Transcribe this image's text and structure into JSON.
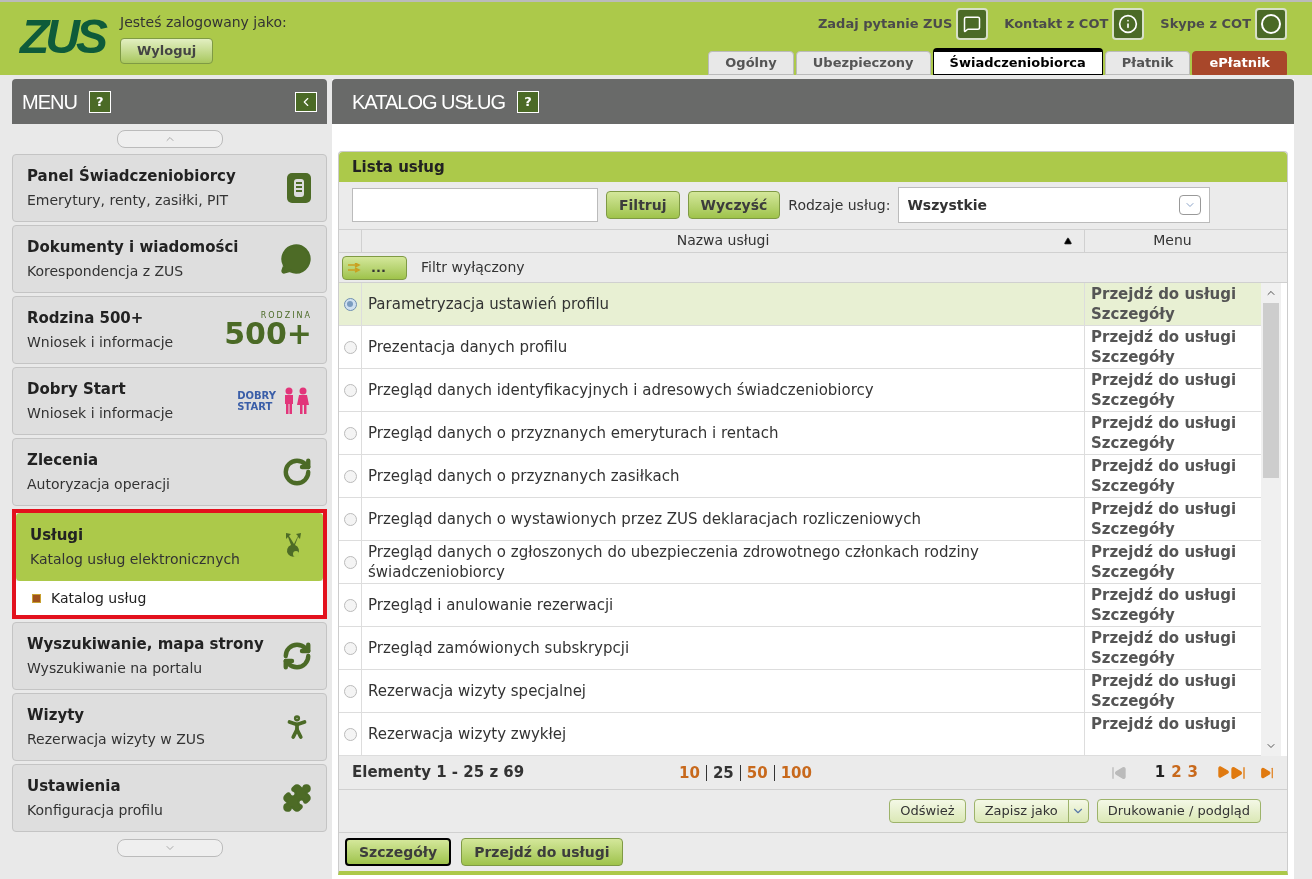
{
  "header": {
    "logo": "ZUS",
    "logged_in_label": "Jesteś zalogowany jako:",
    "logout_button": "Wyloguj",
    "links": [
      {
        "label": "Zadaj pytanie ZUS"
      },
      {
        "label": "Kontakt z COT"
      },
      {
        "label": "Skype z COT"
      }
    ],
    "tabs": [
      {
        "label": "Ogólny",
        "selected": false,
        "kind": "normal"
      },
      {
        "label": "Ubezpieczony",
        "selected": false,
        "kind": "normal"
      },
      {
        "label": "Świadczeniobiorca",
        "selected": true,
        "kind": "normal"
      },
      {
        "label": "Płatnik",
        "selected": false,
        "kind": "normal"
      },
      {
        "label": "ePłatnik",
        "selected": false,
        "kind": "accent"
      }
    ]
  },
  "sidebar": {
    "title": "MENU",
    "help": "?",
    "items": [
      {
        "title": "Panel Świadczeniobiorcy",
        "subtitle": "Emerytury, renty, zasiłki, PIT",
        "selected": false
      },
      {
        "title": "Dokumenty i wiadomości",
        "subtitle": "Korespondencja z ZUS",
        "selected": false
      },
      {
        "title": "Rodzina 500+",
        "subtitle": "Wniosek i informacje",
        "logo": [
          "RODZINA",
          "500+"
        ],
        "selected": false
      },
      {
        "title": "Dobry Start",
        "subtitle": "Wniosek i informacje",
        "logo": [
          "DOBRY",
          "START"
        ],
        "selected": false
      },
      {
        "title": "Zlecenia",
        "subtitle": "Autoryzacja operacji",
        "selected": false
      },
      {
        "title": "Usługi",
        "subtitle": "Katalog usług elektronicznych",
        "selected": true,
        "children": [
          {
            "label": "Katalog usług"
          }
        ]
      },
      {
        "title": "Wyszukiwanie, mapa strony",
        "subtitle": "Wyszukiwanie na portalu",
        "selected": false
      },
      {
        "title": "Wizyty",
        "subtitle": "Rezerwacja wizyty w ZUS",
        "selected": false
      },
      {
        "title": "Ustawienia",
        "subtitle": "Konfiguracja profilu",
        "selected": false
      }
    ]
  },
  "main": {
    "title": "KATALOG USŁUG",
    "help": "?",
    "panel_title": "Lista usług",
    "filter_button": "Filtruj",
    "clear_button": "Wyczyść",
    "type_label": "Rodzaje usług:",
    "type_value": "Wszystkie",
    "columns": [
      "Nazwa usługi",
      "Menu"
    ],
    "filter_toggle": "...",
    "filter_status": "Filtr wyłączony",
    "rows": [
      {
        "name": "Parametryzacja ustawień profilu",
        "selected": true,
        "actions": [
          "Przejdź do usługi",
          "Szczegóły"
        ]
      },
      {
        "name": "Prezentacja danych profilu",
        "selected": false,
        "actions": [
          "Przejdź do usługi",
          "Szczegóły"
        ]
      },
      {
        "name": "Przegląd danych identyfikacyjnych i adresowych świadczeniobiorcy",
        "selected": false,
        "actions": [
          "Przejdź do usługi",
          "Szczegóły"
        ]
      },
      {
        "name": "Przegląd danych o przyznanych emeryturach i rentach",
        "selected": false,
        "actions": [
          "Przejdź do usługi",
          "Szczegóły"
        ]
      },
      {
        "name": "Przegląd danych o przyznanych zasiłkach",
        "selected": false,
        "actions": [
          "Przejdź do usługi",
          "Szczegóły"
        ]
      },
      {
        "name": "Przegląd danych o wystawionych przez ZUS deklaracjach rozliczeniowych",
        "selected": false,
        "actions": [
          "Przejdź do usługi",
          "Szczegóły"
        ]
      },
      {
        "name": "Przegląd danych o zgłoszonych do ubezpieczenia zdrowotnego członkach rodziny świadczeniobiorcy",
        "selected": false,
        "actions": [
          "Przejdź do usługi",
          "Szczegóły"
        ]
      },
      {
        "name": "Przegląd i anulowanie rezerwacji",
        "selected": false,
        "actions": [
          "Przejdź do usługi",
          "Szczegóły"
        ]
      },
      {
        "name": "Przegląd zamówionych subskrypcji",
        "selected": false,
        "actions": [
          "Przejdź do usługi",
          "Szczegóły"
        ]
      },
      {
        "name": "Rezerwacja wizyty specjalnej",
        "selected": false,
        "actions": [
          "Przejdź do usługi",
          "Szczegóły"
        ]
      },
      {
        "name": "Rezerwacja wizyty zwykłej",
        "selected": false,
        "actions": [
          "Przejdź do usługi"
        ]
      }
    ],
    "elements_label": "Elementy 1 - 25 z 69",
    "page_sizes": [
      {
        "label": "10",
        "selected": false
      },
      {
        "label": "25",
        "selected": true
      },
      {
        "label": "50",
        "selected": false
      },
      {
        "label": "100",
        "selected": false
      }
    ],
    "pages": [
      {
        "label": "1",
        "selected": true
      },
      {
        "label": "2",
        "selected": false
      },
      {
        "label": "3",
        "selected": false
      }
    ],
    "refresh_button": "Odśwież",
    "save_button": "Zapisz jako",
    "print_button": "Drukowanie / podgląd",
    "details_button": "Szczegóły",
    "go_button": "Przejdź do usługi"
  }
}
